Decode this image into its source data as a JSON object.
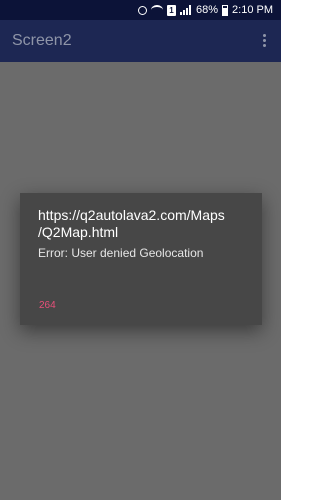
{
  "status_bar": {
    "battery": "68%",
    "time": "2:10 PM",
    "sim_label": "1",
    "icons": [
      "alarm-icon",
      "wifi-icon",
      "sim-icon",
      "signal-icon",
      "battery-icon"
    ]
  },
  "app_bar": {
    "title": "Screen2",
    "menu_icon": "overflow-menu-icon"
  },
  "dialog": {
    "title": "https://q2autolava2.com/Maps\n/Q2Map.html",
    "message": "Error: User denied Geolocation",
    "button_label": "264"
  },
  "colors": {
    "status_bar": "#0c1338",
    "app_bar": "#1d2753",
    "background": "#6b6b6b",
    "dialog": "#474747",
    "accent": "#e8507a"
  }
}
